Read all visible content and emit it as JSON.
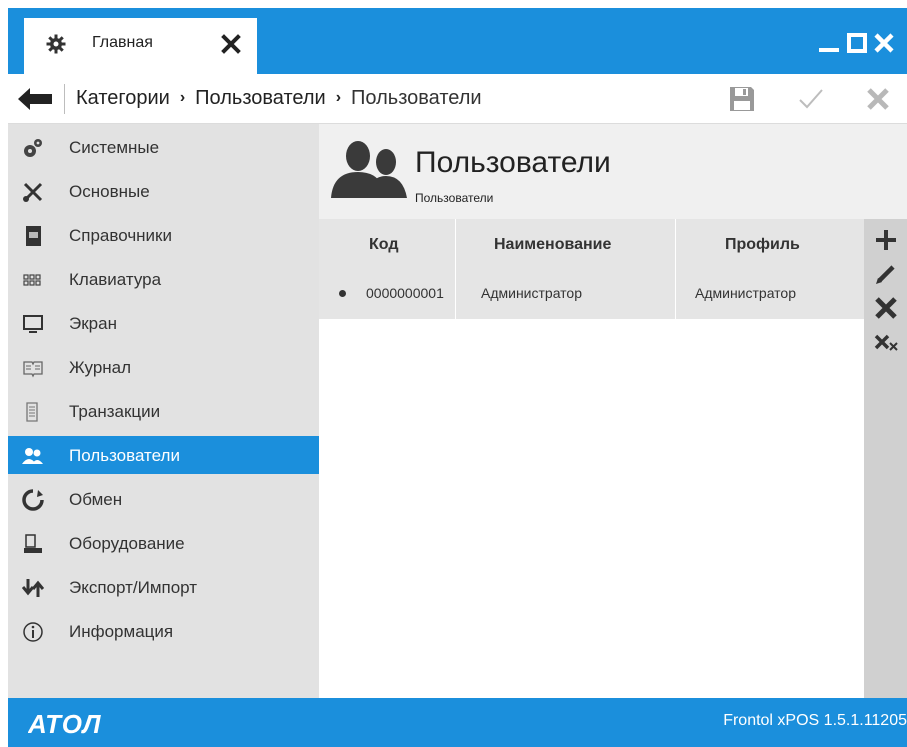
{
  "window": {
    "tab_title": "Главная",
    "tab_icon": "gear-icon",
    "controls": [
      "minimize",
      "maximize",
      "close"
    ]
  },
  "navbar": {
    "breadcrumbs": [
      "Категории",
      "Пользователи",
      "Пользователи"
    ],
    "separator": "›"
  },
  "sidebar": {
    "items": [
      {
        "label": "Системные",
        "icon": "system-gears-icon"
      },
      {
        "label": "Основные",
        "icon": "tools-icon"
      },
      {
        "label": "Справочники",
        "icon": "book-icon"
      },
      {
        "label": "Клавиатура",
        "icon": "keyboard-icon"
      },
      {
        "label": "Экран",
        "icon": "monitor-icon"
      },
      {
        "label": "Журнал",
        "icon": "journal-icon"
      },
      {
        "label": "Транзакции",
        "icon": "receipt-icon"
      },
      {
        "label": "Пользователи",
        "icon": "users-icon",
        "active": true
      },
      {
        "label": "Обмен",
        "icon": "exchange-icon"
      },
      {
        "label": "Оборудование",
        "icon": "equipment-icon"
      },
      {
        "label": "Экспорт/Импорт",
        "icon": "export-import-icon"
      },
      {
        "label": "Информация",
        "icon": "info-icon"
      }
    ]
  },
  "main": {
    "title": "Пользователи",
    "subtitle": "Пользователи",
    "table": {
      "columns": [
        "Код",
        "Наименование",
        "Профиль"
      ],
      "rows": [
        {
          "code": "0000000001",
          "name": "Администратор",
          "profile": "Администратор"
        }
      ]
    }
  },
  "footer": {
    "logo_text": "АТОЛ",
    "version": "Frontol xPOS 1.5.1.11205"
  },
  "colors": {
    "accent": "#1b8fdc",
    "sidebar_bg": "#e2e2e2",
    "grid_bg": "#e5e5e5"
  }
}
